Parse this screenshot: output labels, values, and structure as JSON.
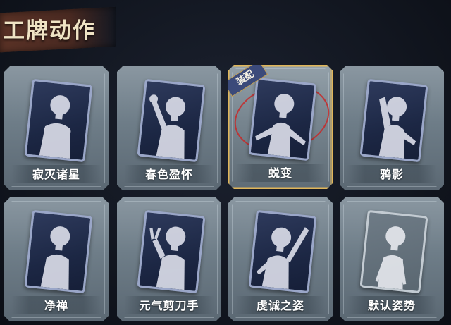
{
  "header": {
    "title": "工牌动作"
  },
  "cards": [
    {
      "label": "寂灭诸星",
      "pose": "hands-at-chest"
    },
    {
      "label": "春色盈怀",
      "pose": "hand-raised-flower"
    },
    {
      "label": "蜕变",
      "pose": "arms-open",
      "equipped": true,
      "tag": "装配"
    },
    {
      "label": "鸦影",
      "pose": "hand-on-head"
    },
    {
      "label": "净禅",
      "pose": "hands-together"
    },
    {
      "label": "元气剪刀手",
      "pose": "peace-sign"
    },
    {
      "label": "虔诚之姿",
      "pose": "arm-raised"
    },
    {
      "label": "默认姿势",
      "pose": "default",
      "default": true
    }
  ],
  "colors": {
    "background": "#10141d",
    "card": "#76848e",
    "equipped_border": "#e0b65a",
    "title_ribbon": "#5a3226",
    "equip_tag": "#3b4a7a",
    "ring": "#c82828"
  }
}
